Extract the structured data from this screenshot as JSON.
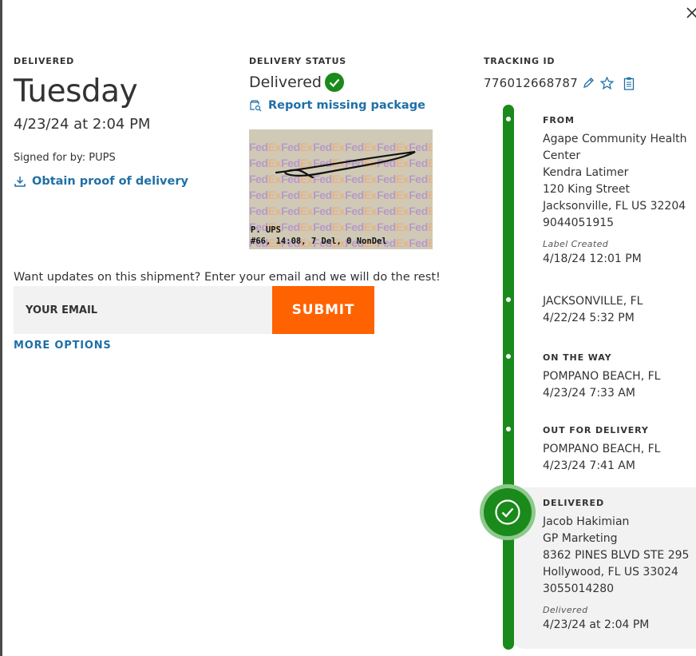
{
  "close": {
    "icon": "close-icon"
  },
  "delivered": {
    "label": "DELIVERED",
    "day": "Tuesday",
    "datetime": "4/23/24 at 2:04 PM",
    "signed_for": "Signed for by: PUPS",
    "proof_link": "Obtain proof of delivery"
  },
  "status": {
    "label": "DELIVERY STATUS",
    "value": "Delivered",
    "report_link": "Report missing package",
    "signature": {
      "watermark": "FedEx",
      "name_line": "P. UPS",
      "detail_line": "#66, 14:08, 7 Del, 0 NonDel"
    }
  },
  "tracking": {
    "label": "TRACKING ID",
    "number": "776012668787"
  },
  "email": {
    "prompt": "Want updates on this shipment? Enter your email and we will do the rest!",
    "placeholder": "YOUR EMAIL",
    "submit": "SUBMIT",
    "more_options": "MORE OPTIONS"
  },
  "timeline": {
    "from": {
      "title": "FROM",
      "lines": [
        "Agape Community Health",
        "Center",
        "Kendra Latimer",
        "120 King Street",
        "Jacksonville, FL US 32204",
        "9044051915"
      ],
      "status": "Label Created",
      "time": "4/18/24 12:01 PM"
    },
    "jax": {
      "location": "JACKSONVILLE, FL",
      "time": "4/22/24 5:32 PM"
    },
    "on_the_way": {
      "title": "ON THE WAY",
      "location": "POMPANO BEACH, FL",
      "time": "4/23/24 7:33 AM"
    },
    "out_for_delivery": {
      "title": "OUT FOR DELIVERY",
      "location": "POMPANO BEACH, FL",
      "time": "4/23/24 7:41 AM"
    },
    "delivered": {
      "title": "DELIVERED",
      "lines": [
        "Jacob Hakimian",
        "GP Marketing",
        "8362 PINES BLVD STE 295",
        "Hollywood, FL US 33024",
        "3055014280"
      ],
      "status": "Delivered",
      "time": "4/23/24 at 2:04 PM"
    }
  },
  "colors": {
    "link": "#1f6fa7",
    "submit": "#ff6200",
    "timeline_green": "#1a8a1a",
    "text": "#333333"
  }
}
